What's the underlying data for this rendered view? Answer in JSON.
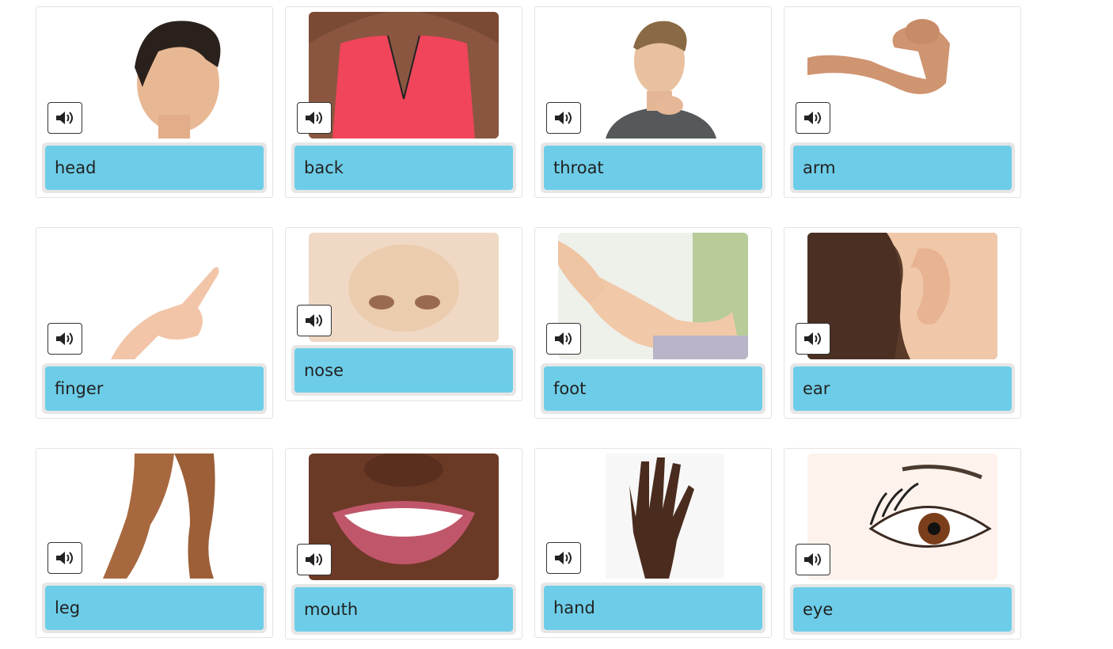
{
  "cards": [
    {
      "word": "head",
      "image": "profile-head-photo"
    },
    {
      "word": "back",
      "image": "back-photo"
    },
    {
      "word": "throat",
      "image": "throat-photo"
    },
    {
      "word": "arm",
      "image": "flexed-arm-photo"
    },
    {
      "word": "finger",
      "image": "pointing-finger-photo"
    },
    {
      "word": "nose",
      "image": "nose-photo"
    },
    {
      "word": "foot",
      "image": "foot-massage-photo"
    },
    {
      "word": "ear",
      "image": "ear-photo"
    },
    {
      "word": "leg",
      "image": "legs-photo"
    },
    {
      "word": "mouth",
      "image": "smiling-mouth-photo"
    },
    {
      "word": "hand",
      "image": "open-hand-photo"
    },
    {
      "word": "eye",
      "image": "eye-photo"
    }
  ],
  "icons": {
    "sound": "speaker-icon"
  },
  "colors": {
    "label_bg": "#6dcde8",
    "label_frame": "#e6e6e6",
    "card_border": "#e3e3e3"
  }
}
